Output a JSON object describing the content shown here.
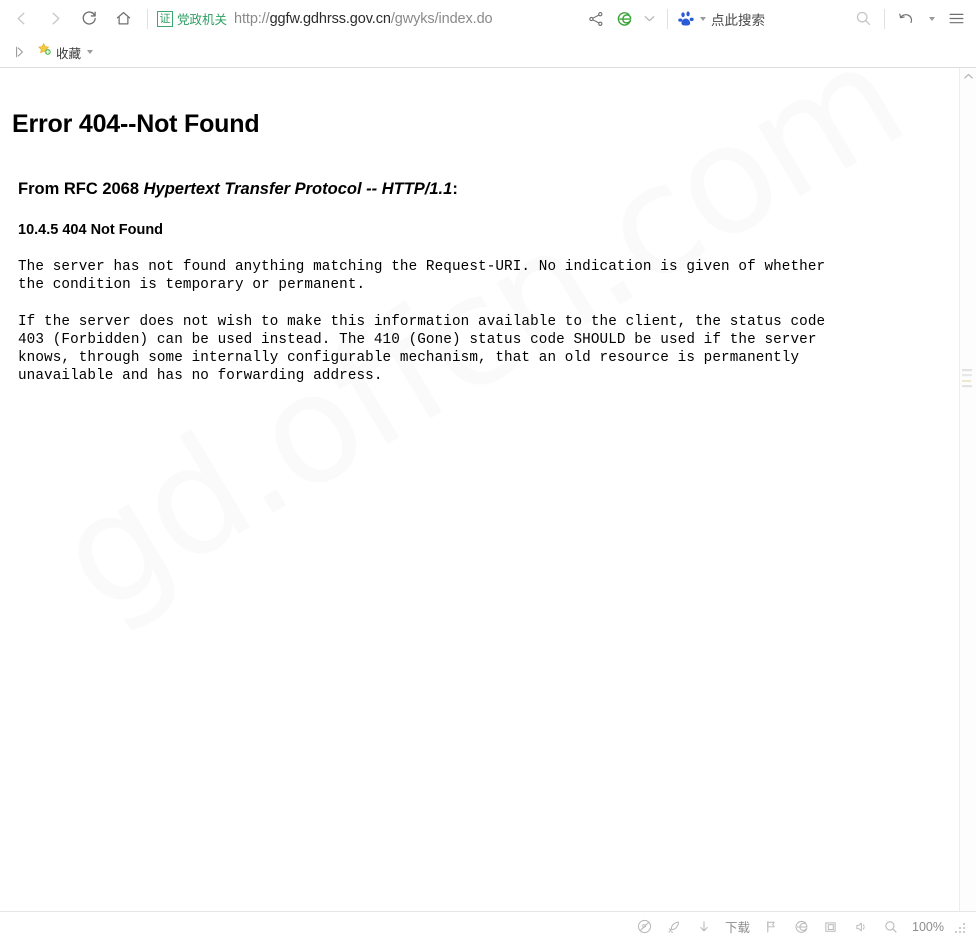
{
  "browser": {
    "nav": {
      "back": "back-arrow",
      "forward": "forward-arrow",
      "reload": "reload",
      "home": "home"
    },
    "address": {
      "gov_badge_mark": "证",
      "gov_badge_label": "党政机关",
      "url_scheme": "http://",
      "url_host": "ggfw.gdhrss.gov.cn",
      "url_path": "/gwyks/index.do",
      "full_url": "http://ggfw.gdhrss.gov.cn/gwyks/index.do"
    },
    "toolbar_icons": {
      "share": "share-icon",
      "ie_engine": "ie-compatibility-icon",
      "engine_dropdown": "chevron-down-icon",
      "search_engine": "baidu-paw-icon",
      "search_hint": "点此搜索",
      "find": "search-icon",
      "history": "history-undo-icon",
      "menu": "hamburger-menu-icon"
    },
    "bookmarks": {
      "toggle": "sidebar-toggle-icon",
      "favorites_label": "收藏",
      "favorites_icon": "star-add-icon"
    }
  },
  "page": {
    "watermark": "gd.offcn.com",
    "title": "Error 404--Not Found",
    "subtitle_prefix": "From RFC 2068 ",
    "subtitle_italic": "Hypertext Transfer Protocol -- HTTP/1.1",
    "subtitle_suffix": ":",
    "section": "10.4.5 404 Not Found",
    "paragraph_1": "The server has not found anything matching the Request-URI. No indication is given of whether\nthe condition is temporary or permanent.",
    "paragraph_2": "If the server does not wish to make this information available to the client, the status code\n403 (Forbidden) can be used instead. The 410 (Gone) status code SHOULD be used if the server\nknows, through some internally configurable mechanism, that an old resource is permanently\nunavailable and has no forwarding address."
  },
  "statusbar": {
    "items": [
      {
        "name": "adblock-icon",
        "label": ""
      },
      {
        "name": "speed-rocket-icon",
        "label": ""
      },
      {
        "name": "download-arrow-icon",
        "label": ""
      },
      {
        "name": "download-label",
        "label": "下载"
      },
      {
        "name": "flag-icon",
        "label": ""
      },
      {
        "name": "ie-compat-icon",
        "label": ""
      },
      {
        "name": "window-split-icon",
        "label": ""
      },
      {
        "name": "volume-icon",
        "label": ""
      },
      {
        "name": "find-icon",
        "label": ""
      }
    ],
    "zoom": "100%"
  },
  "colors": {
    "gov_green": "#2e9e63",
    "redaction_red": "#fe0000",
    "ie_green": "#3aa43a",
    "baidu_blue": "#2a5bd7",
    "text": "#000000",
    "muted": "#8d8d8d"
  }
}
